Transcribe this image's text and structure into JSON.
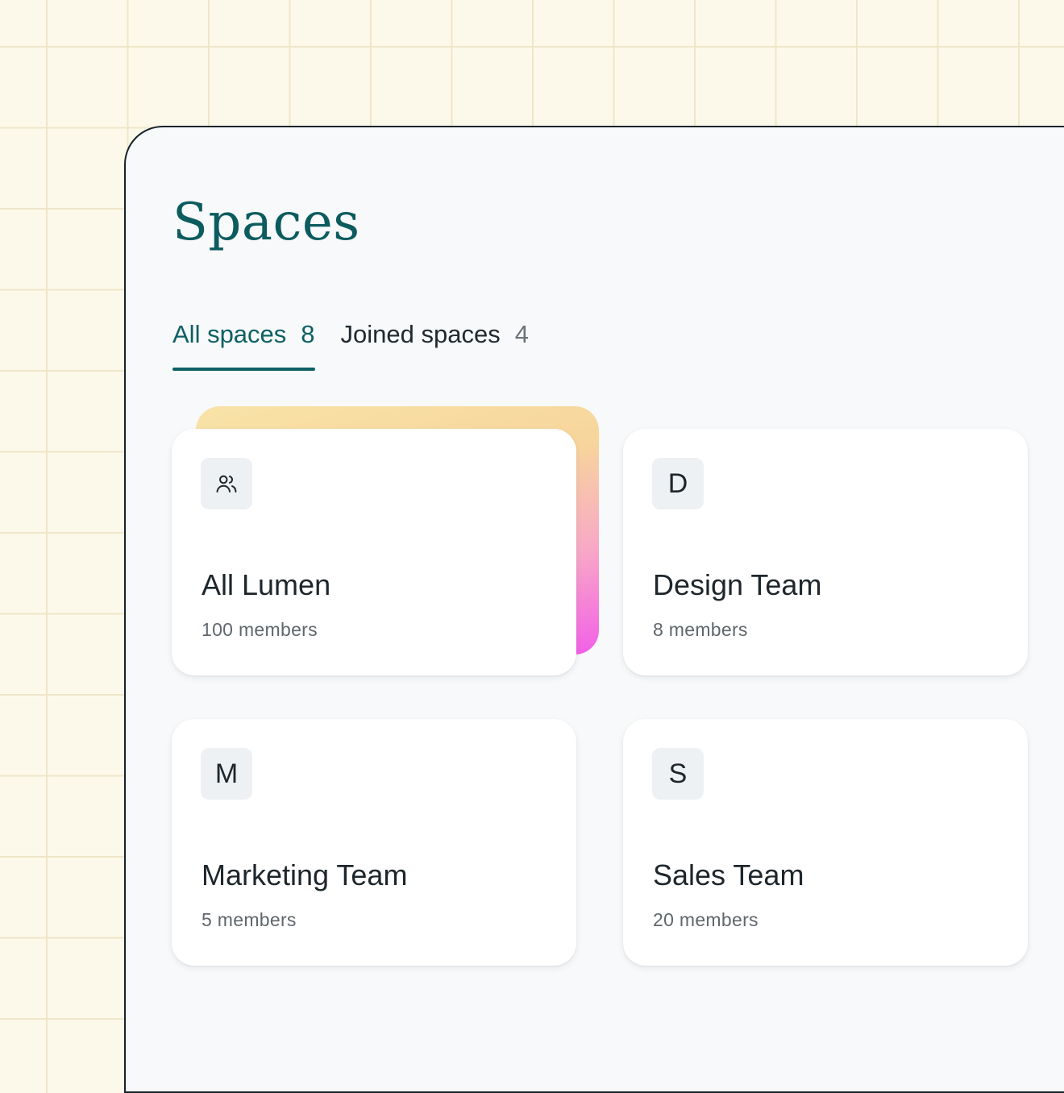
{
  "page": {
    "title": "Spaces"
  },
  "tabs": [
    {
      "label": "All spaces",
      "count": "8",
      "active": true
    },
    {
      "label": "Joined spaces",
      "count": "4",
      "active": false
    }
  ],
  "spaces": [
    {
      "avatar_icon": "users-icon",
      "avatar_letter": "",
      "name": "All Lumen",
      "members": "100 members",
      "highlighted": true
    },
    {
      "avatar_icon": "",
      "avatar_letter": "D",
      "name": "Design Team",
      "members": "8 members",
      "highlighted": false
    },
    {
      "avatar_icon": "",
      "avatar_letter": "M",
      "name": "Marketing Team",
      "members": "5 members",
      "highlighted": false
    },
    {
      "avatar_icon": "",
      "avatar_letter": "S",
      "name": "Sales Team",
      "members": "20 members",
      "highlighted": false
    }
  ],
  "colors": {
    "accent": "#0d6064",
    "page_background": "#fdf9ea",
    "panel_background": "#f7f9fa",
    "highlight_gradient_start": "#f8e3a7",
    "highlight_gradient_end": "#f25ee8"
  }
}
